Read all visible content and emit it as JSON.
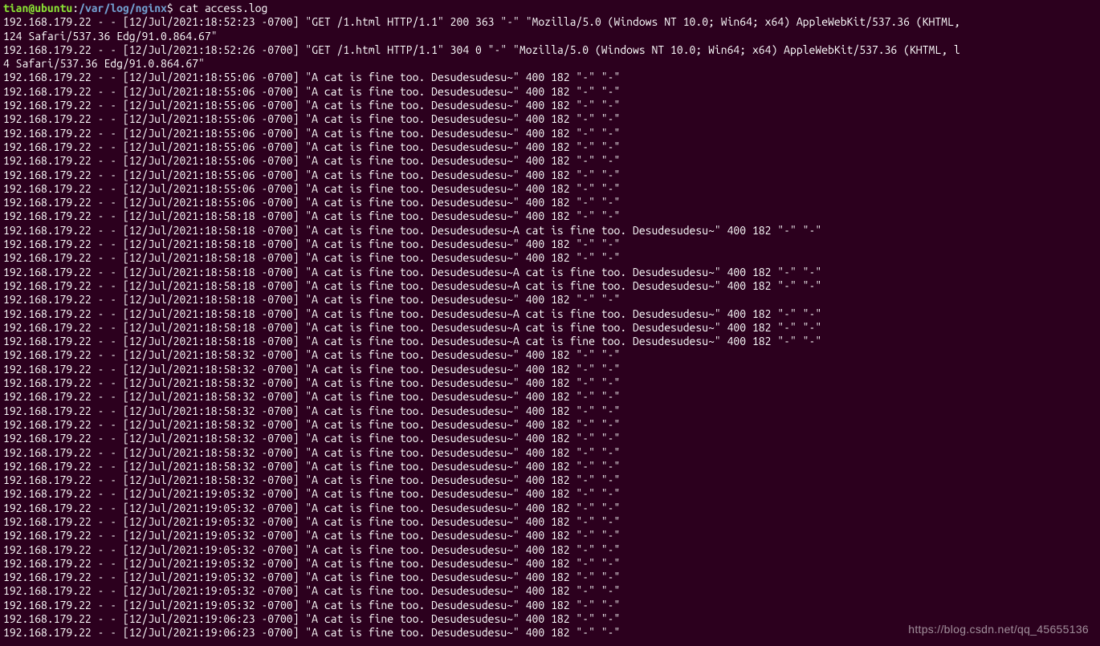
{
  "prompt": {
    "user": "tian",
    "at": "@",
    "host": "ubuntu",
    "colon": ":",
    "path": "/var/log/nginx",
    "dollar": "$",
    "command": " cat access.log"
  },
  "watermark": "https://blog.csdn.net/qq_45655136",
  "log_lines": [
    "192.168.179.22 - - [12/Jul/2021:18:52:23 -0700] \"GET /1.html HTTP/1.1\" 200 363 \"-\" \"Mozilla/5.0 (Windows NT 10.0; Win64; x64) AppleWebKit/537.36 (KHTML,",
    "124 Safari/537.36 Edg/91.0.864.67\"",
    "192.168.179.22 - - [12/Jul/2021:18:52:26 -0700] \"GET /1.html HTTP/1.1\" 304 0 \"-\" \"Mozilla/5.0 (Windows NT 10.0; Win64; x64) AppleWebKit/537.36 (KHTML, l",
    "4 Safari/537.36 Edg/91.0.864.67\"",
    "192.168.179.22 - - [12/Jul/2021:18:55:06 -0700] \"A cat is fine too. Desudesudesu~\" 400 182 \"-\" \"-\"",
    "192.168.179.22 - - [12/Jul/2021:18:55:06 -0700] \"A cat is fine too. Desudesudesu~\" 400 182 \"-\" \"-\"",
    "192.168.179.22 - - [12/Jul/2021:18:55:06 -0700] \"A cat is fine too. Desudesudesu~\" 400 182 \"-\" \"-\"",
    "192.168.179.22 - - [12/Jul/2021:18:55:06 -0700] \"A cat is fine too. Desudesudesu~\" 400 182 \"-\" \"-\"",
    "192.168.179.22 - - [12/Jul/2021:18:55:06 -0700] \"A cat is fine too. Desudesudesu~\" 400 182 \"-\" \"-\"",
    "192.168.179.22 - - [12/Jul/2021:18:55:06 -0700] \"A cat is fine too. Desudesudesu~\" 400 182 \"-\" \"-\"",
    "192.168.179.22 - - [12/Jul/2021:18:55:06 -0700] \"A cat is fine too. Desudesudesu~\" 400 182 \"-\" \"-\"",
    "192.168.179.22 - - [12/Jul/2021:18:55:06 -0700] \"A cat is fine too. Desudesudesu~\" 400 182 \"-\" \"-\"",
    "192.168.179.22 - - [12/Jul/2021:18:55:06 -0700] \"A cat is fine too. Desudesudesu~\" 400 182 \"-\" \"-\"",
    "192.168.179.22 - - [12/Jul/2021:18:55:06 -0700] \"A cat is fine too. Desudesudesu~\" 400 182 \"-\" \"-\"",
    "192.168.179.22 - - [12/Jul/2021:18:58:18 -0700] \"A cat is fine too. Desudesudesu~\" 400 182 \"-\" \"-\"",
    "192.168.179.22 - - [12/Jul/2021:18:58:18 -0700] \"A cat is fine too. Desudesudesu~A cat is fine too. Desudesudesu~\" 400 182 \"-\" \"-\"",
    "192.168.179.22 - - [12/Jul/2021:18:58:18 -0700] \"A cat is fine too. Desudesudesu~\" 400 182 \"-\" \"-\"",
    "192.168.179.22 - - [12/Jul/2021:18:58:18 -0700] \"A cat is fine too. Desudesudesu~\" 400 182 \"-\" \"-\"",
    "192.168.179.22 - - [12/Jul/2021:18:58:18 -0700] \"A cat is fine too. Desudesudesu~A cat is fine too. Desudesudesu~\" 400 182 \"-\" \"-\"",
    "192.168.179.22 - - [12/Jul/2021:18:58:18 -0700] \"A cat is fine too. Desudesudesu~A cat is fine too. Desudesudesu~\" 400 182 \"-\" \"-\"",
    "192.168.179.22 - - [12/Jul/2021:18:58:18 -0700] \"A cat is fine too. Desudesudesu~\" 400 182 \"-\" \"-\"",
    "192.168.179.22 - - [12/Jul/2021:18:58:18 -0700] \"A cat is fine too. Desudesudesu~A cat is fine too. Desudesudesu~\" 400 182 \"-\" \"-\"",
    "192.168.179.22 - - [12/Jul/2021:18:58:18 -0700] \"A cat is fine too. Desudesudesu~A cat is fine too. Desudesudesu~\" 400 182 \"-\" \"-\"",
    "192.168.179.22 - - [12/Jul/2021:18:58:18 -0700] \"A cat is fine too. Desudesudesu~A cat is fine too. Desudesudesu~\" 400 182 \"-\" \"-\"",
    "192.168.179.22 - - [12/Jul/2021:18:58:32 -0700] \"A cat is fine too. Desudesudesu~\" 400 182 \"-\" \"-\"",
    "192.168.179.22 - - [12/Jul/2021:18:58:32 -0700] \"A cat is fine too. Desudesudesu~\" 400 182 \"-\" \"-\"",
    "192.168.179.22 - - [12/Jul/2021:18:58:32 -0700] \"A cat is fine too. Desudesudesu~\" 400 182 \"-\" \"-\"",
    "192.168.179.22 - - [12/Jul/2021:18:58:32 -0700] \"A cat is fine too. Desudesudesu~\" 400 182 \"-\" \"-\"",
    "192.168.179.22 - - [12/Jul/2021:18:58:32 -0700] \"A cat is fine too. Desudesudesu~\" 400 182 \"-\" \"-\"",
    "192.168.179.22 - - [12/Jul/2021:18:58:32 -0700] \"A cat is fine too. Desudesudesu~\" 400 182 \"-\" \"-\"",
    "192.168.179.22 - - [12/Jul/2021:18:58:32 -0700] \"A cat is fine too. Desudesudesu~\" 400 182 \"-\" \"-\"",
    "192.168.179.22 - - [12/Jul/2021:18:58:32 -0700] \"A cat is fine too. Desudesudesu~\" 400 182 \"-\" \"-\"",
    "192.168.179.22 - - [12/Jul/2021:18:58:32 -0700] \"A cat is fine too. Desudesudesu~\" 400 182 \"-\" \"-\"",
    "192.168.179.22 - - [12/Jul/2021:18:58:32 -0700] \"A cat is fine too. Desudesudesu~\" 400 182 \"-\" \"-\"",
    "192.168.179.22 - - [12/Jul/2021:19:05:32 -0700] \"A cat is fine too. Desudesudesu~\" 400 182 \"-\" \"-\"",
    "192.168.179.22 - - [12/Jul/2021:19:05:32 -0700] \"A cat is fine too. Desudesudesu~\" 400 182 \"-\" \"-\"",
    "192.168.179.22 - - [12/Jul/2021:19:05:32 -0700] \"A cat is fine too. Desudesudesu~\" 400 182 \"-\" \"-\"",
    "192.168.179.22 - - [12/Jul/2021:19:05:32 -0700] \"A cat is fine too. Desudesudesu~\" 400 182 \"-\" \"-\"",
    "192.168.179.22 - - [12/Jul/2021:19:05:32 -0700] \"A cat is fine too. Desudesudesu~\" 400 182 \"-\" \"-\"",
    "192.168.179.22 - - [12/Jul/2021:19:05:32 -0700] \"A cat is fine too. Desudesudesu~\" 400 182 \"-\" \"-\"",
    "192.168.179.22 - - [12/Jul/2021:19:05:32 -0700] \"A cat is fine too. Desudesudesu~\" 400 182 \"-\" \"-\"",
    "192.168.179.22 - - [12/Jul/2021:19:05:32 -0700] \"A cat is fine too. Desudesudesu~\" 400 182 \"-\" \"-\"",
    "192.168.179.22 - - [12/Jul/2021:19:05:32 -0700] \"A cat is fine too. Desudesudesu~\" 400 182 \"-\" \"-\"",
    "192.168.179.22 - - [12/Jul/2021:19:06:23 -0700] \"A cat is fine too. Desudesudesu~\" 400 182 \"-\" \"-\"",
    "192.168.179.22 - - [12/Jul/2021:19:06:23 -0700] \"A cat is fine too. Desudesudesu~\" 400 182 \"-\" \"-\""
  ]
}
